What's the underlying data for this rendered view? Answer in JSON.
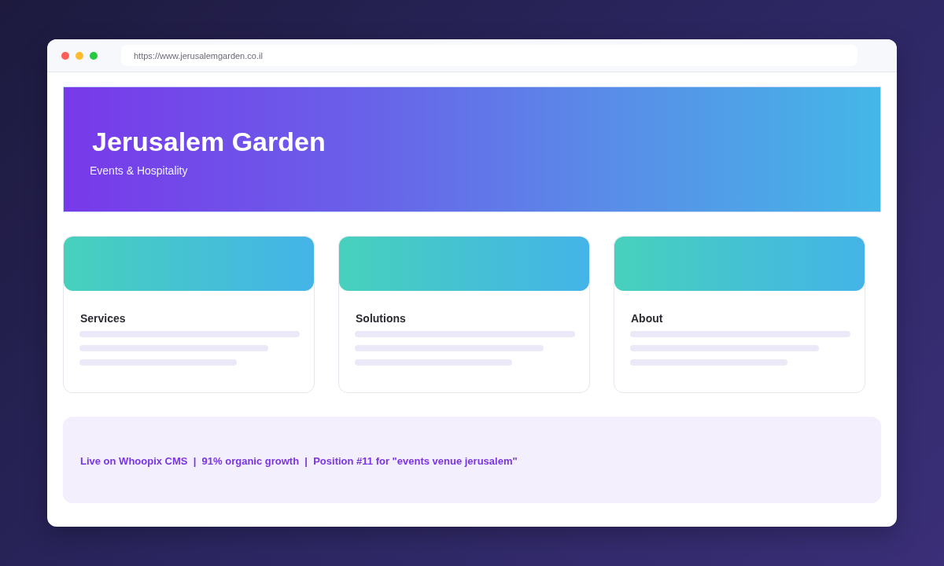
{
  "window": {
    "controls": [
      {
        "color": "#ff5f57"
      },
      {
        "color": "#febc2e"
      },
      {
        "color": "#28c840"
      }
    ],
    "address": "https://www.jerusalemgarden.co.il"
  },
  "hero": {
    "title": "Jerusalem Garden",
    "subtitle": "Events & Hospitality"
  },
  "cards": [
    {
      "title": "Services"
    },
    {
      "title": "Solutions"
    },
    {
      "title": "About"
    }
  ],
  "status_banner": {
    "text": "Live on Whoopix CMS  |  91% organic growth  |  Position #11 for \"events venue jerusalem\""
  }
}
